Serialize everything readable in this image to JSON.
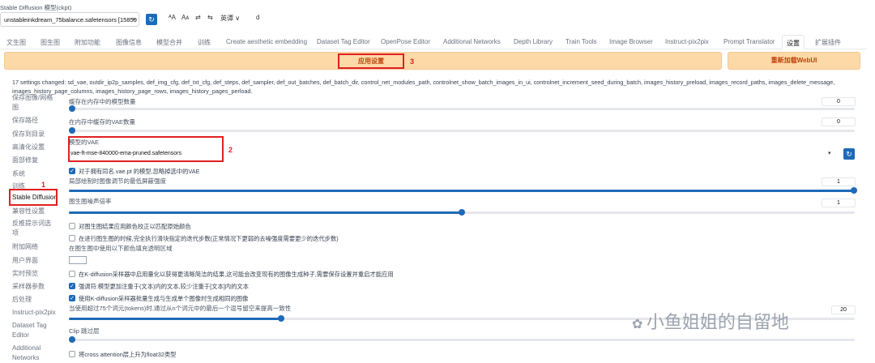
{
  "header": {
    "checkpoint_label": "Stable Diffusion 模型(ckpt)",
    "checkpoint_value": "unstableinkdream_75balance.safetensors [15859",
    "tools": [
      "ᴬA",
      "Aᴀ",
      "⇄",
      "⇆",
      "英谭 ∨",
      "d"
    ]
  },
  "tabs": [
    "文生图",
    "图生图",
    "附加功能",
    "图像信息",
    "模型合并",
    "训练",
    "Create aesthetic embedding",
    "Dataset Tag Editor",
    "OpenPose Editor",
    "Additional Networks",
    "Depth Library",
    "Train Tools",
    "Image Browser",
    "Instruct-pix2pix",
    "Prompt Translator",
    "设置",
    "扩展插件"
  ],
  "active_tab": "设置",
  "buttons": {
    "apply": "应用设置",
    "reload": "重新加载WebUI"
  },
  "annotations": {
    "one": "1",
    "two": "2",
    "three": "3"
  },
  "changed_text": "17 settings changed: sd_vae, outdir_ip2p_samples, def_img_cfg, def_txt_cfg, def_steps, def_sampler, def_out_batches, def_batch_dir, control_net_modules_path, controlnet_show_batch_images_in_ui, controlnet_increment_seed_during_batch, images_history_preload, images_record_paths, images_delete_message, images_history_page_columns, images_history_page_rows, images_history_pages_perload.",
  "sidebar": [
    "保存图像/网格",
    "图",
    "保存路径",
    "保存到目录",
    "高清化设置",
    "面部修复",
    "系统",
    "训练",
    "Stable Diffusion",
    "兼容性设置",
    "反推提示词选",
    "项",
    "附加网络",
    "用户界面",
    "实时预览",
    "采样器参数",
    "后处理",
    "Instruct-pix2pix",
    "Dataset Tag",
    "Editor",
    "Additional",
    "Networks"
  ],
  "settings": {
    "cache_models_label": "缓存在内存中的模型数量",
    "cache_models_value": "0",
    "cache_vae_label": "在内存中缓存的VAE数量",
    "cache_vae_value": "0",
    "vae_label": "模型的VAE",
    "vae_value": "vae-ft-mse-840000-ema-pruned.safetensors",
    "vae_ignore_label": "对于拥有同名.vae.pt 的模型,忽略掉选中的VAE",
    "inpaint_label": "局部绘制时图像调节的最低屏蔽强度",
    "inpaint_value": "1",
    "noise_label": "图生图噪声倍率",
    "noise_value": "1",
    "color_correct_label": "对图生图结果应用颜色校正以匹配原始颜色",
    "img2img_steps_label": "在进行图生图的时候,完全执行滑块指定的迭代步数(正常情况下更弱的去噪强度需要更少的迭代步数)",
    "transparent_label": "在图生图中使用以下颜色填充透明区域",
    "quantize_label": "在K-diffusion采样器中启用量化以获得更清晰简洁的结果,这可能会改变现有的图像生成种子,需要保存设置并重启才能应用",
    "emphasis_label": "强调符:模型更加注重于(文本)内的文本,较少注重于[文本]内的文本",
    "batch_cond_label": "使用K-diffusion采样器批量生成与生成单个图像时生成相同的图像",
    "token_label": "当使用超过75个词元(tokens)时,通过从n个词元中的最后一个逗号留空来提高一致性",
    "token_value": "20",
    "clip_label": "Clip 跳过层",
    "upcast_label": "将cross attention层上升为float32类型"
  },
  "watermark": "小鱼姐姐的自留地",
  "colors": {
    "accent": "#1e6ab8",
    "apply_bg": "#fdd9a8",
    "annotation": "#e02020"
  }
}
